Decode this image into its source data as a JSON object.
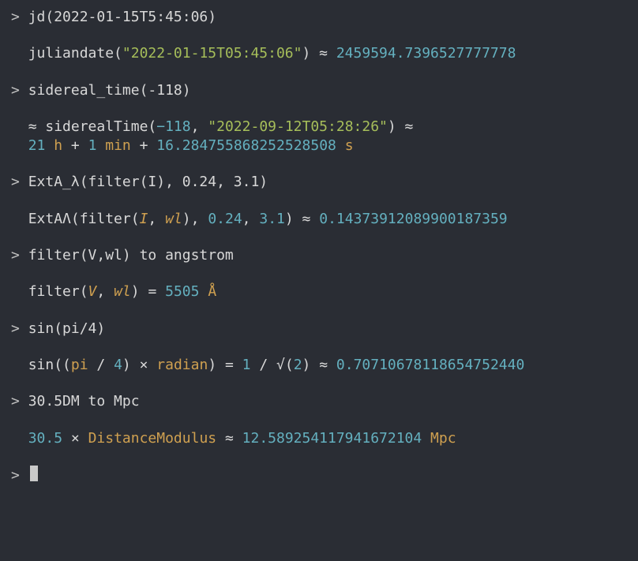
{
  "prompt": ">",
  "entries": [
    {
      "input": {
        "text": "jd(2022-01-15T5:45:06)"
      },
      "output": [
        {
          "segments": [
            {
              "t": "juliandate(",
              "c": "func"
            },
            {
              "t": "\"2022-01-15T05:45:06\"",
              "c": "str"
            },
            {
              "t": ") ≈ ",
              "c": "op"
            },
            {
              "t": "2459594.7396527777778",
              "c": "num"
            }
          ]
        }
      ]
    },
    {
      "input": {
        "text": "sidereal_time(-118)"
      },
      "output": [
        {
          "segments": [
            {
              "t": "≈ siderealTime(",
              "c": "func"
            },
            {
              "t": "−118",
              "c": "num"
            },
            {
              "t": ", ",
              "c": "op"
            },
            {
              "t": "\"2022-09-12T05:28:26\"",
              "c": "str"
            },
            {
              "t": ") ≈",
              "c": "op"
            }
          ]
        },
        {
          "segments": [
            {
              "t": "21",
              "c": "num"
            },
            {
              "t": " h",
              "c": "id"
            },
            {
              "t": " + ",
              "c": "op"
            },
            {
              "t": "1",
              "c": "num"
            },
            {
              "t": " min",
              "c": "id"
            },
            {
              "t": " + ",
              "c": "op"
            },
            {
              "t": "16.284755868252528508",
              "c": "num"
            },
            {
              "t": " s",
              "c": "id"
            }
          ]
        }
      ]
    },
    {
      "input": {
        "text": "ExtA_λ(filter(I), 0.24, 3.1)"
      },
      "output": [
        {
          "segments": [
            {
              "t": "ExtAΛ(filter(",
              "c": "func"
            },
            {
              "t": "I",
              "c": "var"
            },
            {
              "t": ", ",
              "c": "op"
            },
            {
              "t": "wl",
              "c": "var"
            },
            {
              "t": "), ",
              "c": "op"
            },
            {
              "t": "0.24",
              "c": "num"
            },
            {
              "t": ", ",
              "c": "op"
            },
            {
              "t": "3.1",
              "c": "num"
            },
            {
              "t": ") ≈ ",
              "c": "op"
            },
            {
              "t": "0.14373912089900187359",
              "c": "num"
            }
          ]
        }
      ]
    },
    {
      "input": {
        "text": "filter(V,wl) to angstrom"
      },
      "output": [
        {
          "segments": [
            {
              "t": "filter(",
              "c": "func"
            },
            {
              "t": "V",
              "c": "var"
            },
            {
              "t": ", ",
              "c": "op"
            },
            {
              "t": "wl",
              "c": "var"
            },
            {
              "t": ") = ",
              "c": "op"
            },
            {
              "t": "5505",
              "c": "num"
            },
            {
              "t": " Å",
              "c": "id"
            }
          ]
        }
      ]
    },
    {
      "input": {
        "text": "sin(pi/4)"
      },
      "output": [
        {
          "segments": [
            {
              "t": "sin((",
              "c": "func"
            },
            {
              "t": "pi",
              "c": "id"
            },
            {
              "t": " / ",
              "c": "op"
            },
            {
              "t": "4",
              "c": "num"
            },
            {
              "t": ") × ",
              "c": "op"
            },
            {
              "t": "radian",
              "c": "id"
            },
            {
              "t": ") = ",
              "c": "op"
            },
            {
              "t": "1",
              "c": "num"
            },
            {
              "t": " / √(",
              "c": "op"
            },
            {
              "t": "2",
              "c": "num"
            },
            {
              "t": ") ≈ ",
              "c": "op"
            },
            {
              "t": "0.70710678118654752440",
              "c": "num"
            }
          ]
        }
      ]
    },
    {
      "input": {
        "text": "30.5DM to Mpc"
      },
      "output": [
        {
          "segments": [
            {
              "t": "30.5",
              "c": "num"
            },
            {
              "t": " × ",
              "c": "op"
            },
            {
              "t": "DistanceModulus",
              "c": "id"
            },
            {
              "t": " ≈ ",
              "c": "op"
            },
            {
              "t": "12.589254117941672104",
              "c": "num"
            },
            {
              "t": " Mpc",
              "c": "id"
            }
          ]
        }
      ]
    }
  ],
  "active_prompt": ">"
}
